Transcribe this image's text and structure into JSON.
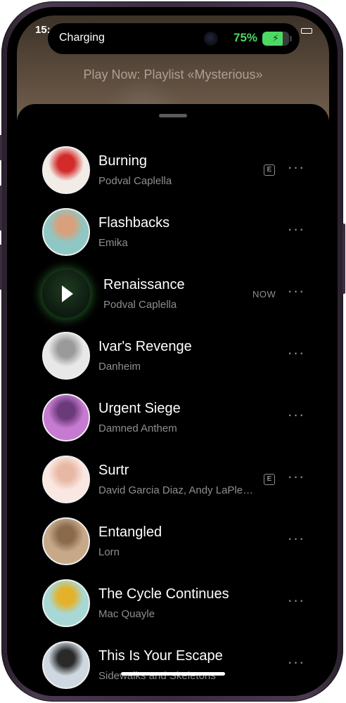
{
  "status": {
    "time": "15:",
    "charging_label": "Charging",
    "battery_percent": "75%",
    "battery_level": 0.75
  },
  "now_playing_banner": "Play Now: Playlist «Mysterious»",
  "icons": {
    "more": "···",
    "explicit": "E"
  },
  "tracks": [
    {
      "title": "Burning",
      "artist": "Podval Caplella",
      "explicit": true,
      "cover_colors": [
        "#f2ece6",
        "#d32a2a"
      ]
    },
    {
      "title": "Flashbacks",
      "artist": "Emika",
      "explicit": false,
      "cover_colors": [
        "#8fc7c4",
        "#d9a07c"
      ]
    },
    {
      "title": "Renaissance",
      "artist": "Podval Caplella",
      "current": true,
      "now_label": "NOW",
      "cover_colors": [
        "#0d1a10",
        "#1f3a20"
      ]
    },
    {
      "title": "Ivar's Revenge",
      "artist": "Danheim",
      "explicit": false,
      "cover_colors": [
        "#e8e8e8",
        "#9a9a9a"
      ]
    },
    {
      "title": "Urgent Siege",
      "artist": "Damned Anthem",
      "explicit": false,
      "cover_colors": [
        "#c77ad1",
        "#6a3a7a"
      ]
    },
    {
      "title": "Surtr",
      "artist": "David Garcia Diaz, Andy LaPle…",
      "explicit": true,
      "cover_colors": [
        "#fbe7e2",
        "#e7b9a4"
      ]
    },
    {
      "title": "Entangled",
      "artist": "Lorn",
      "explicit": false,
      "cover_colors": [
        "#c7a98a",
        "#8b6a4c"
      ]
    },
    {
      "title": "The Cycle Continues",
      "artist": "Mac Quayle",
      "explicit": false,
      "cover_colors": [
        "#a8d8d6",
        "#e3b22a"
      ]
    },
    {
      "title": "This Is Your Escape",
      "artist": "Sidewalks and Skeletons",
      "explicit": false,
      "cover_colors": [
        "#cfd8e0",
        "#2a2a2a"
      ]
    }
  ],
  "colors": {
    "accent_green": "#4cd964",
    "secondary_text": "#8e8e93",
    "sheet_background": "#000000"
  }
}
